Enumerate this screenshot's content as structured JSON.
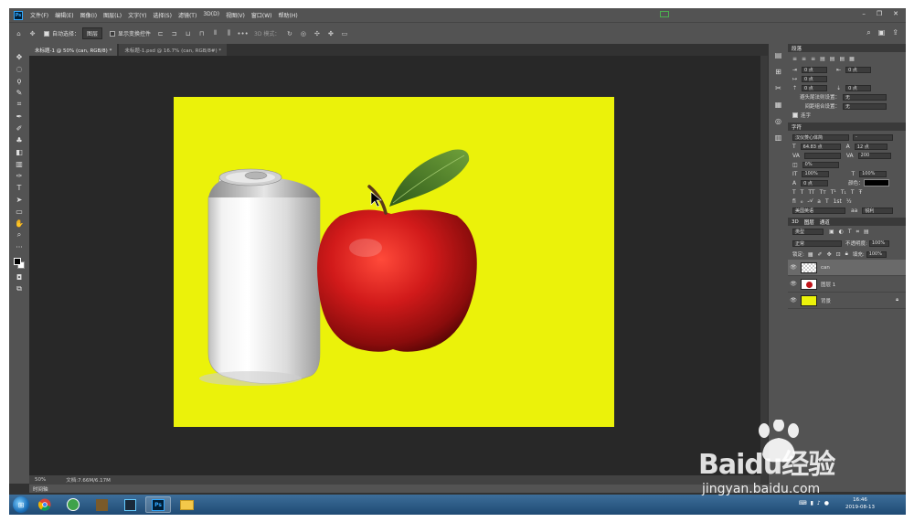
{
  "menubar": {
    "items": [
      "文件(F)",
      "编辑(E)",
      "图像(I)",
      "图层(L)",
      "文字(Y)",
      "选择(S)",
      "滤镜(T)",
      "3D(D)",
      "视图(V)",
      "窗口(W)",
      "帮助(H)"
    ]
  },
  "options": {
    "auto_select_label": "自动选择：",
    "auto_select_value": "图层",
    "transform_label": "显示变换控件",
    "mode_3d": "3D 模式："
  },
  "tabs": [
    {
      "label": "未标题-1 @ 50% (can, RGB/8) *"
    },
    {
      "label": "未标题-1.psd @ 16.7% (can, RGB/8#) *"
    }
  ],
  "status": {
    "zoom": "50%",
    "doc": "文档:7.66M/6.17M"
  },
  "timeline_label": "时间轴",
  "paragraph": {
    "title": "段落",
    "indent_left": "0 点",
    "indent_right": "0 点",
    "indent_first": "0 点",
    "space_before": "0 点",
    "space_after": "0 点",
    "kinsoku_label": "避头尾法则设置：",
    "kinsoku_value": "无",
    "mojikumi_label": "间距组合设置：",
    "mojikumi_value": "无",
    "hyphen_label": "连字"
  },
  "character": {
    "title": "字符",
    "font": "汉仪菱心体简",
    "style": "-",
    "size": "64.83 点",
    "leading": "12 点",
    "kerning": "",
    "tracking": "200",
    "scale_pct": "0%",
    "vscale": "100%",
    "hscale": "100%",
    "baseline": "0 点",
    "color_label": "颜色：",
    "language": "美国英语",
    "aa": "锐利"
  },
  "layers_panel": {
    "tabs": [
      "3D",
      "图层",
      "通道"
    ],
    "filter": "类型",
    "blend": "正常",
    "opacity_label": "不透明度:",
    "opacity": "100%",
    "lock_label": "锁定:",
    "fill_label": "填充:",
    "fill": "100%",
    "layers": [
      {
        "name": "can",
        "active": true
      },
      {
        "name": "图层 1",
        "active": false
      },
      {
        "name": "背景",
        "active": false
      }
    ]
  },
  "taskbar": {
    "time": "16:46",
    "date": "2019-08-13"
  },
  "watermark": {
    "text": "Baidu经验",
    "sub": "jingyan.baidu.com"
  },
  "colors": {
    "canvas_bg": "#ebf20a",
    "apple": "#c0141a",
    "ui": "#535353"
  }
}
